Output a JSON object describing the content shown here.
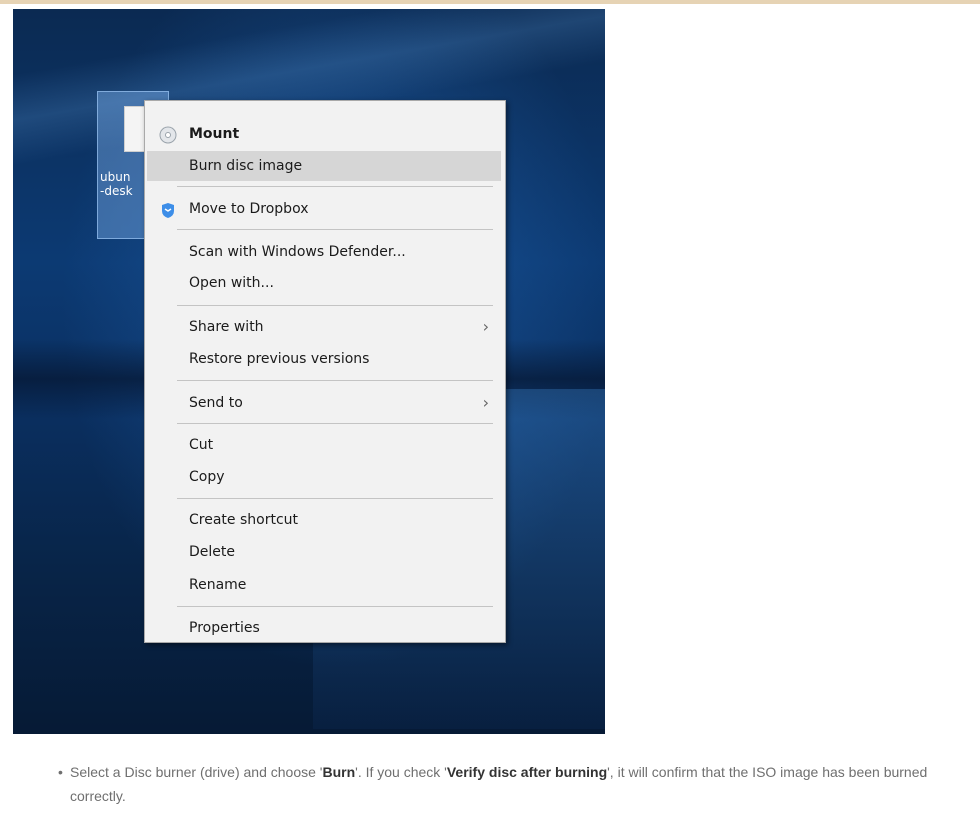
{
  "menu": {
    "items": [
      {
        "label": "Mount",
        "icon": "disc-icon"
      },
      {
        "label": "Burn disc image"
      },
      {
        "label": "Move to Dropbox",
        "icon": "dropbox-icon"
      },
      {
        "label": "Scan with Windows Defender..."
      },
      {
        "label": "Open with..."
      },
      {
        "label": "Share with"
      },
      {
        "label": "Restore previous versions"
      },
      {
        "label": "Send to"
      },
      {
        "label": "Cut"
      },
      {
        "label": "Copy"
      },
      {
        "label": "Create shortcut"
      },
      {
        "label": "Delete"
      },
      {
        "label": "Rename"
      },
      {
        "label": "Properties"
      }
    ]
  },
  "desktop_icon": {
    "label_line1": "ubun",
    "label_line2": "-desk"
  },
  "caption": {
    "text1": "Select a Disc burner (drive) and choose '",
    "bold1": "Burn",
    "text2": "'. If you check '",
    "bold2": "Verify disc after burning",
    "text3": "', it will confirm that the ISO image has been burned correctly."
  },
  "colors": {
    "highlight": "#d6d6d6",
    "menu_bg": "#f2f2f2",
    "desktop_blue": "#0c3a73"
  }
}
